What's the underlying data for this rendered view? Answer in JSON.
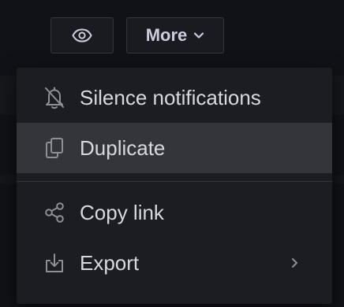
{
  "toolbar": {
    "view_icon": "eye-icon",
    "more_label": "More",
    "more_icon": "chevron-down-icon"
  },
  "menu": {
    "items": [
      {
        "label": "Silence notifications",
        "icon": "bell-slash-icon",
        "active": false
      },
      {
        "label": "Duplicate",
        "icon": "copy-icon",
        "active": true
      },
      {
        "label": "Copy link",
        "icon": "share-icon",
        "active": false
      },
      {
        "label": "Export",
        "icon": "download-icon",
        "active": false,
        "submenu": true
      }
    ]
  },
  "colors": {
    "background": "#111217",
    "menu_bg": "#1c1d22",
    "active_bg": "#34353b",
    "text": "#d8d9e0",
    "icon": "#8e8f96",
    "border": "#34363c"
  }
}
